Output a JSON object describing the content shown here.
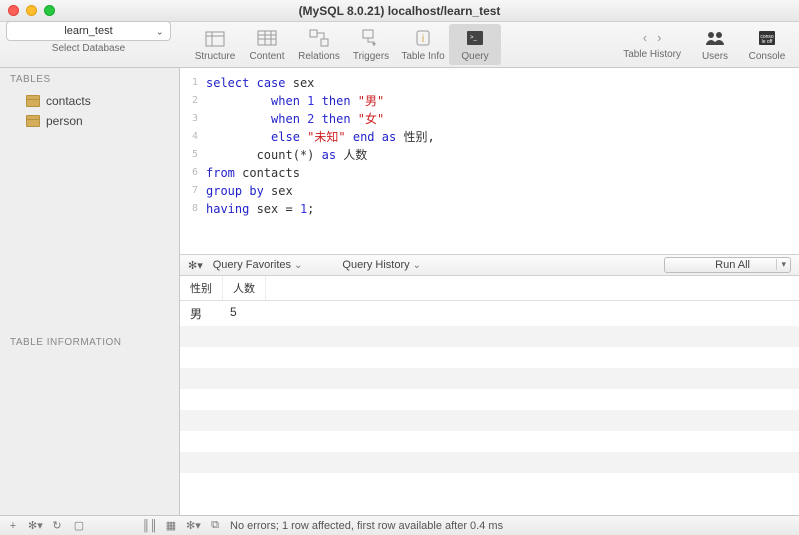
{
  "window": {
    "title": "(MySQL 8.0.21) localhost/learn_test"
  },
  "database_selector": {
    "value": "learn_test",
    "label": "Select Database"
  },
  "toolbar": {
    "items": [
      {
        "label": "Structure"
      },
      {
        "label": "Content"
      },
      {
        "label": "Relations"
      },
      {
        "label": "Triggers"
      },
      {
        "label": "Table Info"
      },
      {
        "label": "Query"
      }
    ],
    "active_index": 5,
    "right": [
      {
        "label": "Table History"
      },
      {
        "label": "Users"
      },
      {
        "label": "Console"
      }
    ]
  },
  "sidebar": {
    "sections": {
      "tables": "TABLES",
      "info": "TABLE INFORMATION"
    },
    "tables": [
      {
        "name": "contacts"
      },
      {
        "name": "person"
      }
    ]
  },
  "code": {
    "lines": [
      [
        [
          "kw",
          "select"
        ],
        [
          "",
          " "
        ],
        [
          "kw",
          "case"
        ],
        [
          "",
          " sex"
        ]
      ],
      [
        [
          "",
          "         "
        ],
        [
          "kw",
          "when"
        ],
        [
          "",
          " "
        ],
        [
          "num",
          "1"
        ],
        [
          "",
          " "
        ],
        [
          "kw",
          "then"
        ],
        [
          "",
          " "
        ],
        [
          "str",
          "\"男\""
        ]
      ],
      [
        [
          "",
          "         "
        ],
        [
          "kw",
          "when"
        ],
        [
          "",
          " "
        ],
        [
          "num",
          "2"
        ],
        [
          "",
          " "
        ],
        [
          "kw",
          "then"
        ],
        [
          "",
          " "
        ],
        [
          "str",
          "\"女\""
        ]
      ],
      [
        [
          "",
          "         "
        ],
        [
          "kw",
          "else"
        ],
        [
          "",
          " "
        ],
        [
          "str",
          "\"未知\""
        ],
        [
          "",
          " "
        ],
        [
          "kw",
          "end"
        ],
        [
          "",
          " "
        ],
        [
          "kw",
          "as"
        ],
        [
          "",
          " 性别,"
        ]
      ],
      [
        [
          "",
          "       count(*) "
        ],
        [
          "kw",
          "as"
        ],
        [
          "",
          " 人数"
        ]
      ],
      [
        [
          "kw",
          "from"
        ],
        [
          "",
          " contacts"
        ]
      ],
      [
        [
          "kw",
          "group"
        ],
        [
          "",
          " "
        ],
        [
          "kw",
          "by"
        ],
        [
          "",
          " sex"
        ]
      ],
      [
        [
          "kw",
          "having"
        ],
        [
          "",
          " sex = "
        ],
        [
          "num",
          "1"
        ],
        [
          "",
          ";"
        ]
      ]
    ]
  },
  "midbar": {
    "favorites": "Query Favorites",
    "history": "Query History",
    "runall": "Run All"
  },
  "results": {
    "columns": [
      "性别",
      "人数"
    ],
    "rows": [
      [
        "男",
        "5"
      ]
    ]
  },
  "statusbar": {
    "text": "No errors; 1 row affected, first row available after 0.4 ms"
  }
}
